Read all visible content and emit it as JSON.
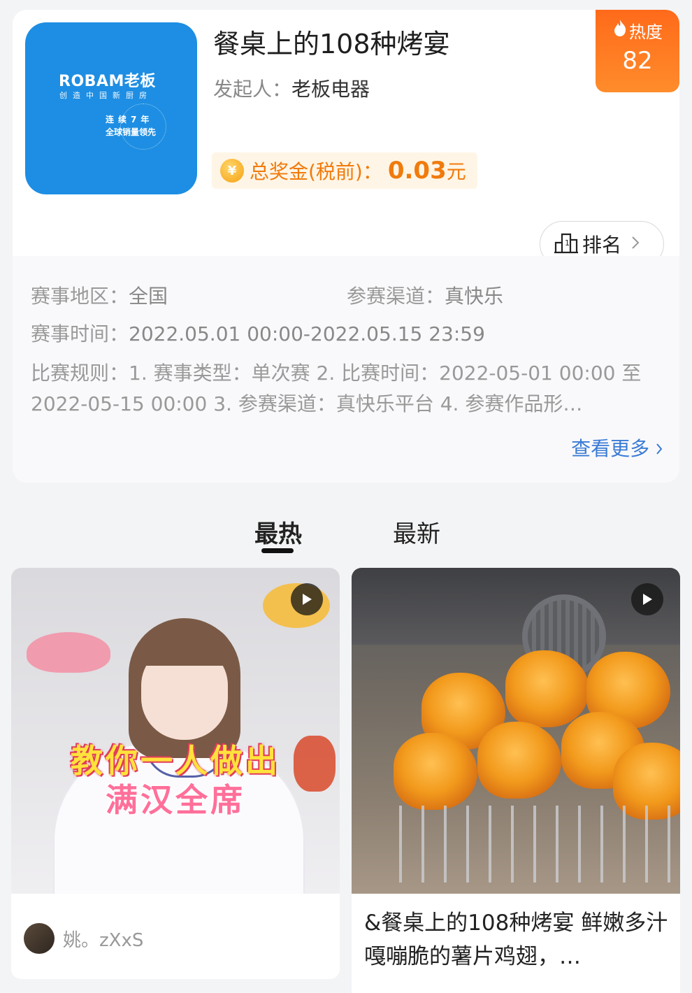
{
  "contest": {
    "logo": {
      "brand": "ROBAM老板",
      "tagline": "创造中国新厨房",
      "badge_line1": "连续7年",
      "badge_line2": "全球销量领先"
    },
    "title": "餐桌上的108种烤宴",
    "initiator_label": "发起人：",
    "initiator_value": "老板电器",
    "prize_coin": "¥",
    "prize_label": "总奖金(税前)：",
    "prize_value": "0.03",
    "prize_unit": "元",
    "heat_label": "热度",
    "heat_value": "82",
    "rank_label": "排名",
    "region_label": "赛事地区：",
    "region_value": "全国",
    "channel_label": "参赛渠道：",
    "channel_value": "真快乐",
    "time_label": "赛事时间：",
    "time_value": "2022.05.01 00:00-2022.05.15 23:59",
    "rules_text": "比赛规则：1. 赛事类型：单次赛 2. 比赛时间：2022-05-01 00:00 至 2022-05-15 00:00 3. 参赛渠道：真快乐平台 4. 参赛作品形…",
    "see_more": "查看更多"
  },
  "tabs": [
    {
      "label": "最热",
      "active": true
    },
    {
      "label": "最新",
      "active": false
    }
  ],
  "feed": [
    {
      "overlay_line1": "教你一人做出",
      "overlay_line2": "满汉全席",
      "author": "姚。zXxS",
      "type": "video"
    },
    {
      "title": "&餐桌上的108种烤宴 鲜嫩多汁嘎嘣脆的薯片鸡翅，…",
      "type": "video"
    }
  ],
  "colors": {
    "accent_orange": "#f07b0c",
    "link_blue": "#3a7bd5",
    "logo_blue": "#1d8ee3",
    "heat_orange": "#ff6a1a"
  },
  "icons": [
    "play-icon",
    "flame-icon",
    "ranking-icon",
    "chevron-right-icon",
    "coin-icon"
  ]
}
